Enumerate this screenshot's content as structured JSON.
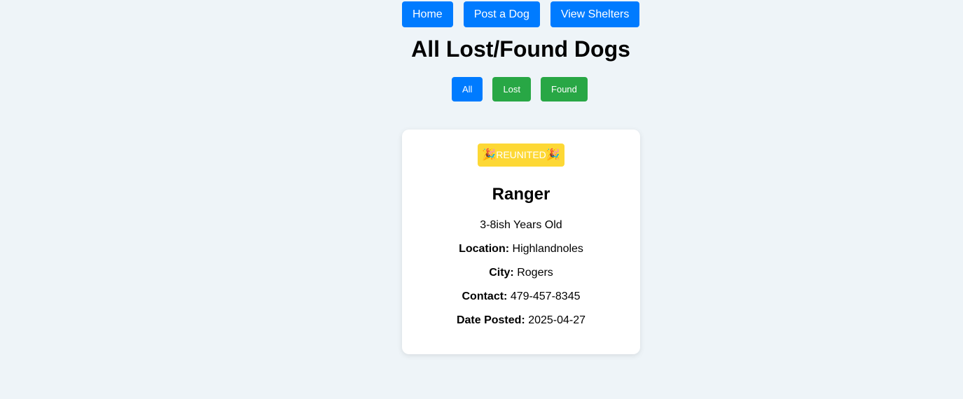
{
  "nav": {
    "home": "Home",
    "post": "Post a Dog",
    "shelters": "View Shelters"
  },
  "page": {
    "title": "All Lost/Found Dogs"
  },
  "filters": {
    "all": "All",
    "lost": "Lost",
    "found": "Found"
  },
  "dog": {
    "badge_emoji": "🎉",
    "badge_text": "REUNITED",
    "name": "Ranger",
    "age": "3-8ish Years Old",
    "location_label": "Location:",
    "location": "Highlandnoles",
    "city_label": "City:",
    "city": "Rogers",
    "contact_label": "Contact:",
    "contact": "479-457-8345",
    "date_label": "Date Posted:",
    "date": "2025-04-27"
  },
  "colors": {
    "primary": "#007bff",
    "success": "#28a745",
    "badge": "#fdd835",
    "background": "#eef4f8"
  }
}
